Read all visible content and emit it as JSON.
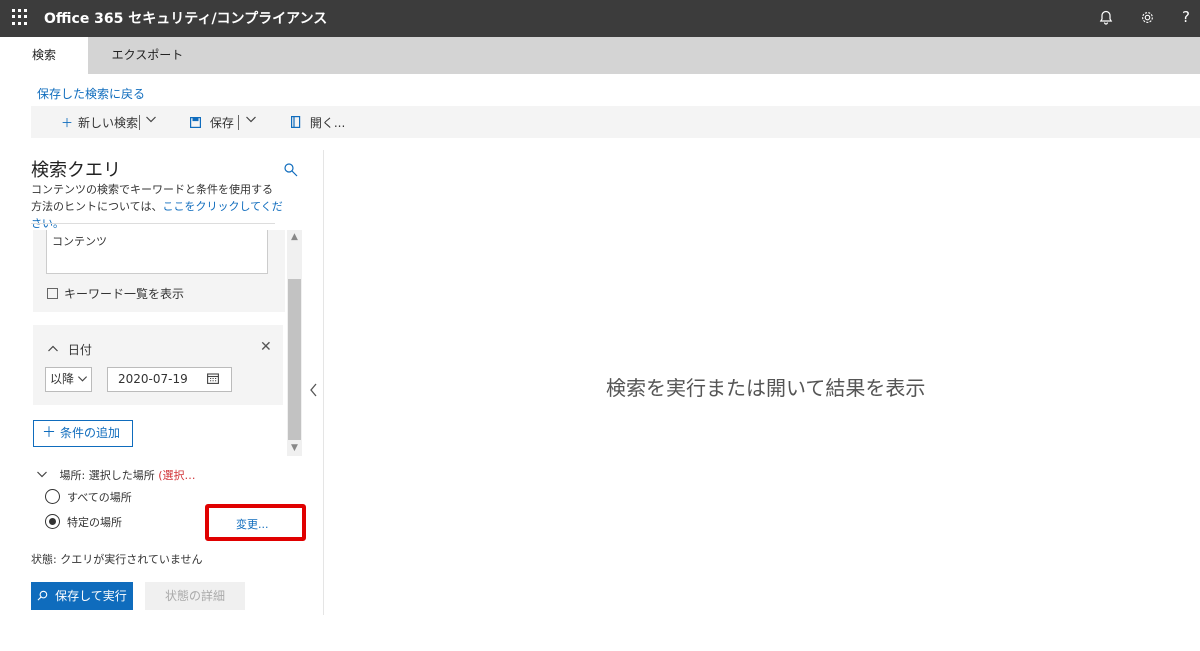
{
  "header": {
    "title": "Office 365 セキュリティ/コンプライアンス",
    "bell_icon": "bell-icon",
    "settings_icon": "gear-icon",
    "help_label": "?"
  },
  "tabs": [
    {
      "label": "検索",
      "active": true
    },
    {
      "label": "エクスポート",
      "active": false
    }
  ],
  "back_link": "保存した検索に戻る",
  "toolbar": {
    "new_search": "新しい検索",
    "save": "保存",
    "open": "開く..."
  },
  "query_pane": {
    "title": "検索クエリ",
    "desc_text": "コンテンツの検索でキーワードと条件を使用する方法のヒントについては、",
    "desc_link": "ここをクリックしてください。",
    "keyword_value": "コンテンツ",
    "keyword_list_label": "キーワード一覧を表示",
    "date_condition": {
      "label": "日付",
      "operator": "以降",
      "value": "2020-07-19"
    },
    "add_condition": "条件の追加",
    "location": {
      "label": "場所: 選択した場所",
      "extra": "(選択…",
      "option_all": "すべての場所",
      "option_specific": "特定の場所",
      "selected": "specific",
      "change_link": "変更..."
    },
    "status": "状態: クエリが実行されていません",
    "run_button": "保存して実行",
    "detail_button": "状態の詳細"
  },
  "results": {
    "empty_message": "検索を実行または開いて結果を表示"
  },
  "colors": {
    "accent": "#0f6cbd",
    "header_bg": "#3c3c3c",
    "highlight": "#e00000"
  }
}
